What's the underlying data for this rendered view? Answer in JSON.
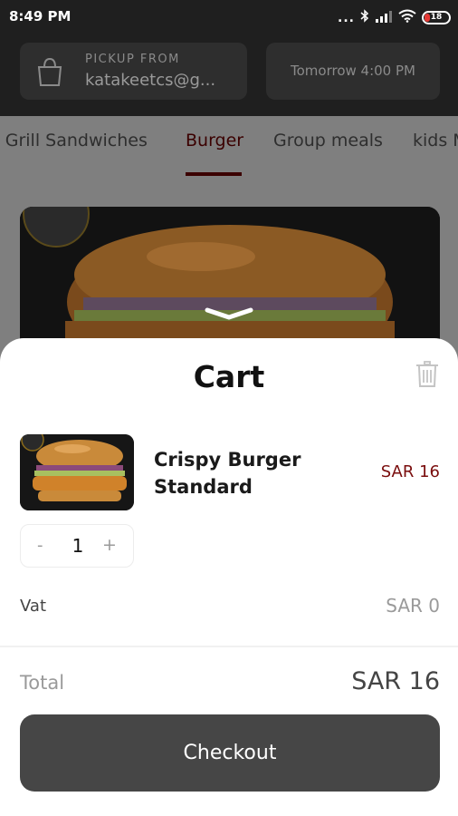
{
  "status_bar": {
    "time": "8:49 PM",
    "dots": "...",
    "battery": "18"
  },
  "pickup": {
    "label": "PICKUP FROM",
    "value": "katakeetcs@g..."
  },
  "pickup_time": "Tomorrow 4:00 PM",
  "categories": {
    "tabs": [
      {
        "label": "e Grill Sandwiches",
        "active": false
      },
      {
        "label": "Burger",
        "active": true
      },
      {
        "label": "Group meals",
        "active": false
      },
      {
        "label": "kids M",
        "active": false
      }
    ]
  },
  "cart": {
    "title": "Cart",
    "items": [
      {
        "name": "Crispy Burger Standard",
        "price": "SAR 16",
        "quantity": "1"
      }
    ],
    "qty_minus": "-",
    "qty_plus": "+",
    "vat_label": "Vat",
    "vat_value": "SAR 0",
    "total_label": "Total",
    "total_value": "SAR 16",
    "checkout_label": "Checkout"
  },
  "colors": {
    "accent": "#7a0d0d",
    "checkout_button": "#464646"
  }
}
